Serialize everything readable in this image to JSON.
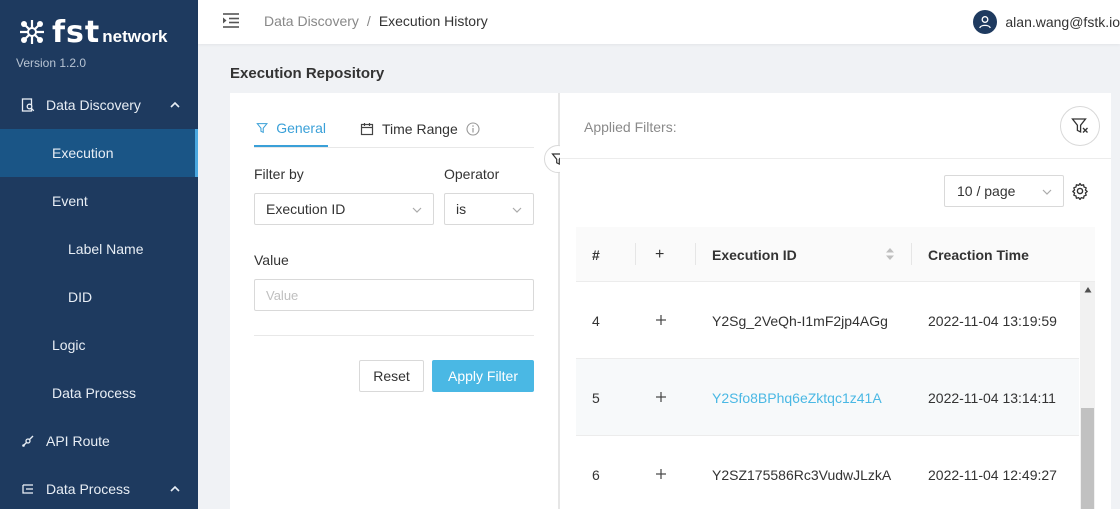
{
  "brand": {
    "name": "fst",
    "sub": "network",
    "version": "Version 1.2.0"
  },
  "sidebar": {
    "items": [
      {
        "label": "Data Discovery"
      },
      {
        "label": "Execution"
      },
      {
        "label": "Event"
      },
      {
        "label": "Label Name"
      },
      {
        "label": "DID"
      },
      {
        "label": "Logic"
      },
      {
        "label": "Data Process"
      },
      {
        "label": "API Route"
      },
      {
        "label": "Data Process"
      }
    ]
  },
  "breadcrumb": {
    "parent": "Data Discovery",
    "separator": "/",
    "current": "Execution History"
  },
  "user": {
    "email": "alan.wang@fstk.io"
  },
  "page": {
    "title": "Execution Repository"
  },
  "filter": {
    "tabs": [
      {
        "label": "General"
      },
      {
        "label": "Time Range"
      }
    ],
    "filter_by_label": "Filter by",
    "filter_by_value": "Execution ID",
    "operator_label": "Operator",
    "operator_value": "is",
    "value_label": "Value",
    "value_placeholder": "Value",
    "reset_label": "Reset",
    "apply_label": "Apply Filter"
  },
  "results": {
    "applied_filters_label": "Applied Filters:",
    "page_size": "10 / page",
    "columns": {
      "index": "#",
      "expand": "+",
      "execution_id": "Execution ID",
      "creation_time": "Creaction Time"
    },
    "rows": [
      {
        "index": "4",
        "execution_id": "Y2Sg_2VeQh-I1mF2jp4AGg",
        "creation_time": "2022-11-04 13:19:59"
      },
      {
        "index": "5",
        "execution_id": "Y2Sfo8BPhq6eZktqc1z41A",
        "creation_time": "2022-11-04 13:14:11"
      },
      {
        "index": "6",
        "execution_id": "Y2SZ175586Rc3VudwJLzkA",
        "creation_time": "2022-11-04 12:49:27"
      }
    ]
  },
  "colors": {
    "sidebar": "#1e3a5f",
    "accent": "#4ab8e4",
    "active_nav": "#1a5586"
  }
}
